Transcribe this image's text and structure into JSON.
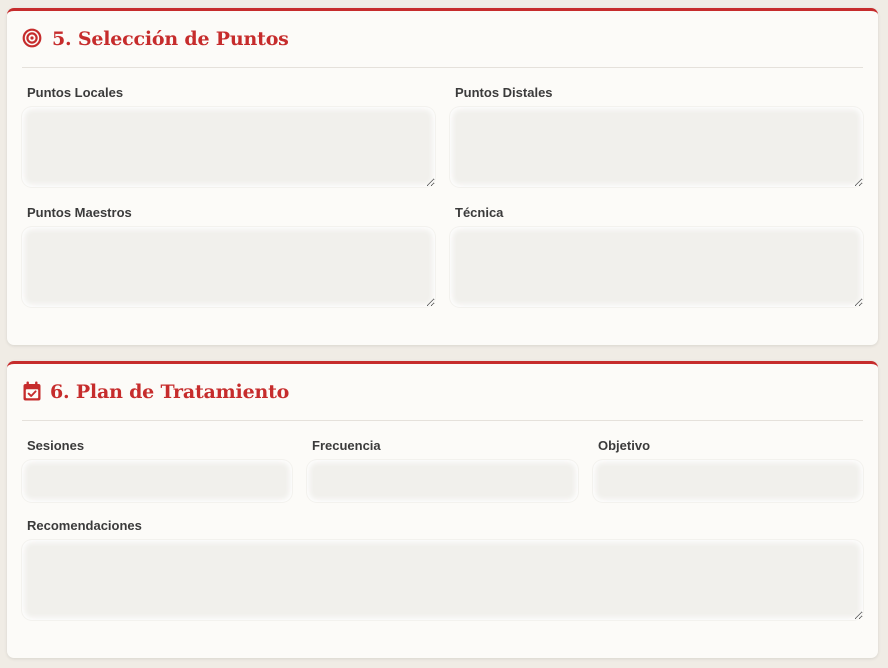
{
  "section5": {
    "title": "5. Selección de Puntos",
    "icon": "target-icon",
    "fields": {
      "puntos_locales": {
        "label": "Puntos Locales",
        "value": ""
      },
      "puntos_distales": {
        "label": "Puntos Distales",
        "value": ""
      },
      "puntos_maestros": {
        "label": "Puntos Maestros",
        "value": ""
      },
      "tecnica": {
        "label": "Técnica",
        "value": ""
      }
    }
  },
  "section6": {
    "title": "6. Plan de Tratamiento",
    "icon": "calendar-check-icon",
    "fields": {
      "sesiones": {
        "label": "Sesiones",
        "value": ""
      },
      "frecuencia": {
        "label": "Frecuencia",
        "value": ""
      },
      "objetivo": {
        "label": "Objetivo",
        "value": ""
      },
      "recomendaciones": {
        "label": "Recomendaciones",
        "value": ""
      }
    }
  },
  "colors": {
    "accent": "#c62c2c",
    "card_background": "#fcfbf8",
    "page_background": "#f0ece5",
    "field_background": "#f1f0ec",
    "label_text": "#3b3b3b"
  }
}
